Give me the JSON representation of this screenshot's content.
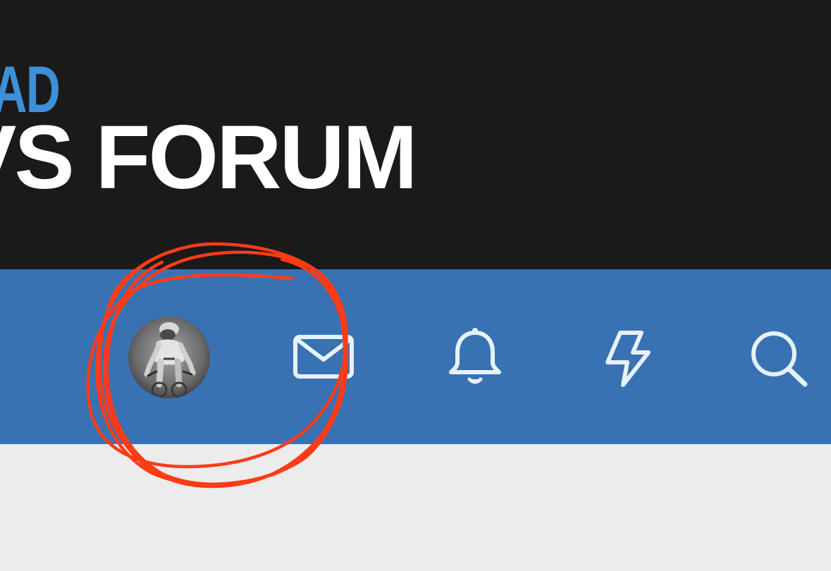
{
  "header": {
    "logo_top": "RAD",
    "logo_main": "VS FORUM"
  },
  "nav": {
    "avatar": "user-avatar-cyclist",
    "icons": [
      "mail-icon",
      "bell-icon",
      "lightning-icon",
      "search-icon"
    ]
  },
  "colors": {
    "header_bg": "#1a1a1a",
    "logo_accent": "#3d8fd6",
    "nav_bg": "#3872b3",
    "icon_color": "#e7f1fb",
    "annotation_color": "#ff3b17",
    "page_bg": "#ececec"
  }
}
